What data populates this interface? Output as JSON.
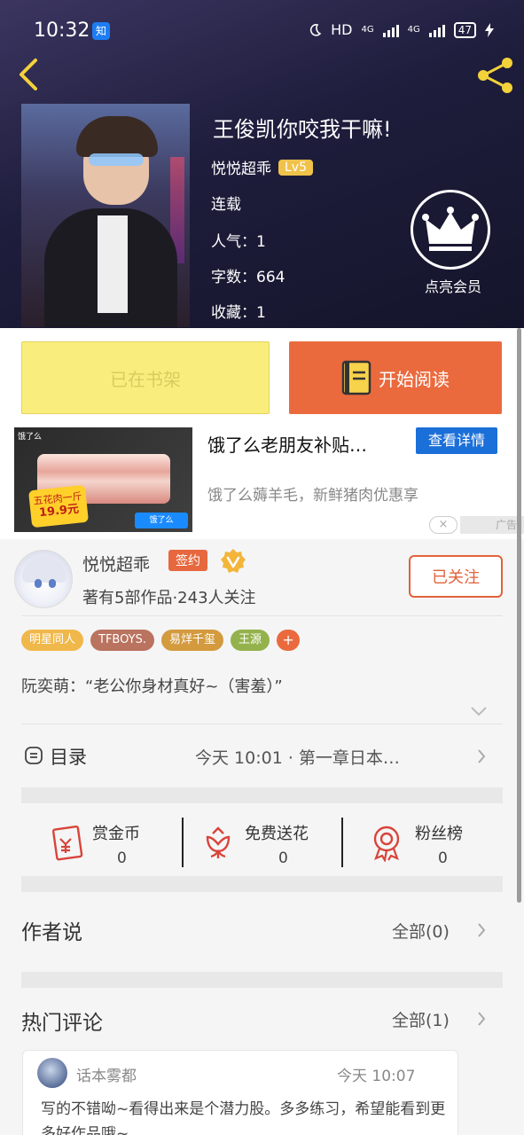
{
  "status_bar": {
    "time": "10:32",
    "app_icon": "知",
    "hd": "HD",
    "net1": "4G",
    "net2": "4G",
    "battery": "47"
  },
  "book": {
    "title": "王俊凯你咬我干嘛!",
    "author": "悦悦超乖",
    "level": "Lv5",
    "status": "连载",
    "popularity_label": "人气：",
    "popularity": "1",
    "words_label": "字数：",
    "words": "664",
    "favorites_label": "收藏：",
    "favorites": "1",
    "vip_label": "点亮会员"
  },
  "actions": {
    "shelf_label": "已在书架",
    "read_label": "开始阅读"
  },
  "ad": {
    "title": "饿了么老朋友补贴…",
    "detail_label": "查看详情",
    "description": "饿了么薅羊毛，新鲜猪肉优惠享",
    "close": "×",
    "tag": "广告",
    "img_brand": "饿了么",
    "img_price_line1": "五花肉一斤",
    "img_price_line2": "19.9元",
    "img_button": "饿了么"
  },
  "author_card": {
    "name": "悦悦超乖",
    "sign_badge": "签约",
    "stats": "著有5部作品·243人关注",
    "follow_label": "已关注",
    "tags": [
      {
        "label": "明星同人",
        "color": "#f0b84a"
      },
      {
        "label": "TFBOYS.",
        "color": "#b9735e"
      },
      {
        "label": "易烊千玺",
        "color": "#d39a3e"
      },
      {
        "label": "王源",
        "color": "#94b24c"
      }
    ],
    "add_tag": "+",
    "intro": "阮奕萌：“老公你身材真好~（害羞）”"
  },
  "toc": {
    "label": "目录",
    "update": "今天  10:01 · 第一章日本…"
  },
  "support": [
    {
      "label": "赏金币",
      "value": "0",
      "icon": "redpacket-icon"
    },
    {
      "label": "免费送花",
      "value": "0",
      "icon": "flower-icon"
    },
    {
      "label": "粉丝榜",
      "value": "0",
      "icon": "medal-icon"
    }
  ],
  "author_says": {
    "title": "作者说",
    "more": "全部(0)"
  },
  "hot_comments": {
    "title": "热门评论",
    "more": "全部(1)",
    "items": [
      {
        "user": "话本雾都",
        "time": "今天  10:07",
        "text": "写的不错呦~看得出来是个潜力股。多多练习，希望能看到更多好作品哦~"
      }
    ]
  },
  "colors": {
    "accent": "#ea6a3e",
    "shelf": "#f9ee7d",
    "level": "#f0c24a",
    "ad_blue": "#1b6fd9"
  }
}
